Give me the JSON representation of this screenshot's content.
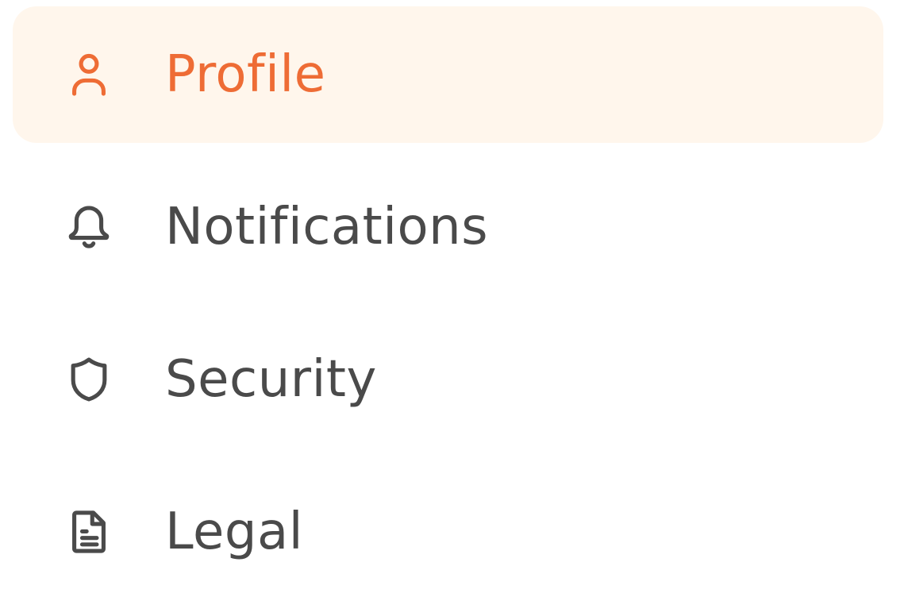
{
  "colors": {
    "accent": "#ee6c35",
    "active_bg": "#fff6ec",
    "text": "#4a4a4a"
  },
  "menu": {
    "items": [
      {
        "label": "Profile",
        "icon": "user-icon",
        "active": true
      },
      {
        "label": "Notifications",
        "icon": "bell-icon",
        "active": false
      },
      {
        "label": "Security",
        "icon": "shield-icon",
        "active": false
      },
      {
        "label": "Legal",
        "icon": "document-icon",
        "active": false
      }
    ]
  }
}
